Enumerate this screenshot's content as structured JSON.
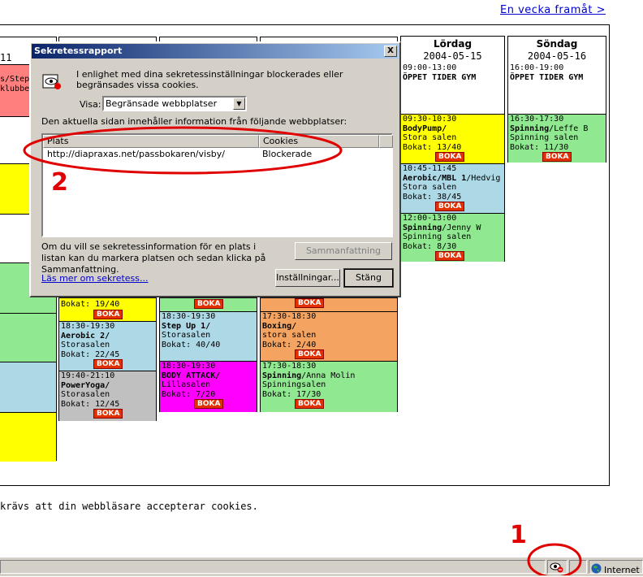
{
  "nav": {
    "next_week": "En vecka framåt >"
  },
  "days": [
    {
      "name": "Lördag",
      "date": "2004-05-15"
    },
    {
      "name": "Söndag",
      "date": "2004-05-16"
    }
  ],
  "partial_left_texts": {
    "date_11": "11",
    "s_step": "s/Step",
    "klubbe": "klubbe"
  },
  "booking_label": "BOKA",
  "col_c1": [
    {
      "line1": "Bokat: 19/40"
    },
    {
      "time": "18:30-19:30",
      "name": "Aerobic 2/",
      "place": "Storasalen",
      "booked": "Bokat: 22/45"
    },
    {
      "time": "19:40-21:10",
      "name": "PowerYoga/",
      "place": "Storasalen",
      "booked": "Bokat: 12/45"
    }
  ],
  "col_c2": [
    {
      "time": "18:30-19:30",
      "name": "Step Up 1/",
      "place": "Storasalen",
      "booked": "Bokat: 40/40"
    },
    {
      "time": "18:30-19:30",
      "name": "BODY ATTACK/",
      "place": "Lillasalen",
      "booked": "Bokat: 7/20"
    }
  ],
  "col_c3": [
    {
      "time": "17:30-18:30",
      "name": "Boxing/",
      "place": "stora salen",
      "booked": "Bokat: 2/40"
    },
    {
      "time": "17:30-18:30",
      "name": "Spinning",
      "instructor": "/Anna Molin",
      "place": "Spinningsalen",
      "booked": "Bokat: 17/30"
    }
  ],
  "saturday": [
    {
      "time": "09:00-13:00",
      "name": "ÖPPET TIDER GYM"
    },
    {
      "time": "09:30-10:30",
      "name": "BodyPump/",
      "place": "Stora salen",
      "booked": "Bokat: 13/40"
    },
    {
      "time": "10:45-11:45",
      "name": "Aerobic/MBL 1",
      "instructor": "/Hedvig",
      "place": "Stora salen",
      "booked": "Bokat: 38/45"
    },
    {
      "time": "12:00-13:00",
      "name": "Spinning",
      "instructor": "/Jenny W",
      "place": "Spinning salen",
      "booked": "Bokat: 8/30"
    }
  ],
  "sunday": [
    {
      "time": "16:00-19:00",
      "name": "ÖPPET TIDER GYM"
    },
    {
      "time": "16:30-17:30",
      "name": "Spinning",
      "instructor": "/Leffe B",
      "place": "Spinning salen",
      "booked": "Bokat: 11/30"
    }
  ],
  "footnote": "krävs att din webbläsare accepterar cookies.",
  "statusbar": {
    "zone": "Internet"
  },
  "annotations": {
    "one": "1",
    "two": "2"
  },
  "dialog": {
    "title": "Sekretessrapport",
    "close": "X",
    "info": "I enlighet med dina sekretessinställningar blockerades eller begränsades vissa cookies.",
    "view_label": "Visa:",
    "view_selected": "Begränsade webbplatser",
    "list_caption": "Den aktuella sidan innehåller information från följande webbplatser:",
    "col_site": "Plats",
    "col_cookies": "Cookies",
    "rows": [
      {
        "site": "http://diapraxas.net/passbokaren/visby/",
        "cookies": "Blockerade"
      }
    ],
    "hint": "Om du vill se sekretessinformation för en plats i listan kan du markera platsen och sedan klicka på Sammanfattning.",
    "summary_button": "Sammanfattning",
    "learn_more": "Läs mer om sekretess...",
    "settings_button": "Inställningar...",
    "close_button": "Stäng"
  },
  "colors": {
    "highlight_red": "#e00000",
    "boka": "#e33000",
    "title_blue": "#0a246a"
  }
}
